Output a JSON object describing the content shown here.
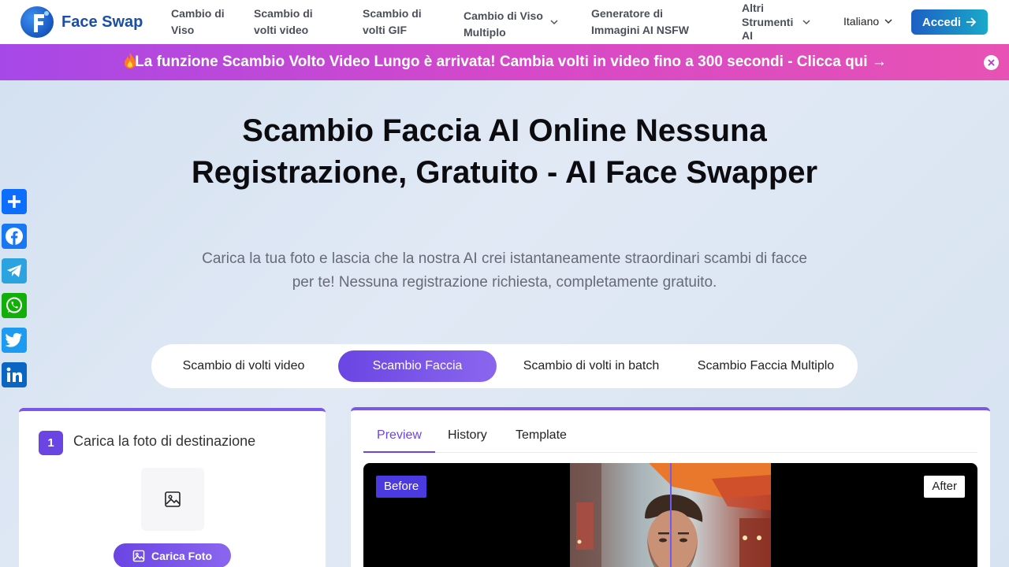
{
  "brand": {
    "name": "Face Swap"
  },
  "nav": {
    "items": [
      {
        "label": "Cambio di Viso"
      },
      {
        "label": "Scambio di volti video"
      },
      {
        "label": "Scambio di volti GIF"
      },
      {
        "label": "Cambio di Viso Multiplo"
      },
      {
        "label": "Generatore di Immagini AI NSFW"
      },
      {
        "label": "Altri Strumenti AI"
      }
    ],
    "language": "Italiano",
    "login": "Accedi"
  },
  "banner": {
    "icon": "fire-icon",
    "text": "La funzione Scambio Volto Video Lungo è arrivata! Cambia volti in video fino a 300 secondi - Clicca qui →"
  },
  "social": [
    "share-icon",
    "facebook-icon",
    "telegram-icon",
    "whatsapp-icon",
    "twitter-icon",
    "linkedin-icon"
  ],
  "hero": {
    "title": "Scambio Faccia AI Online Nessuna Registrazione, Gratuito - AI Face Swapper",
    "subtitle": "Carica la tua foto e lascia che la nostra AI crei istantaneamente straordinari scambi di facce per te! Nessuna registrazione richiesta, completamente gratuito."
  },
  "mode_tabs": {
    "items": [
      {
        "label": "Scambio di volti video"
      },
      {
        "label": "Scambio Faccia"
      },
      {
        "label": "Scambio di volti in batch"
      },
      {
        "label": "Scambio Faccia Multiplo"
      }
    ],
    "active": "Scambio Faccia"
  },
  "upload_card": {
    "step": "1",
    "title": "Carica la foto di destinazione",
    "button": "Carica Foto"
  },
  "preview_card": {
    "tabs": [
      {
        "label": "Preview"
      },
      {
        "label": "History"
      },
      {
        "label": "Template"
      }
    ],
    "active_tab": "Preview",
    "before_label": "Before",
    "after_label": "After"
  },
  "colors": {
    "accent": "#6b45e3",
    "brand_blue": "#1a4fa8",
    "banner_start": "#a648e8",
    "banner_end": "#e752b4"
  }
}
